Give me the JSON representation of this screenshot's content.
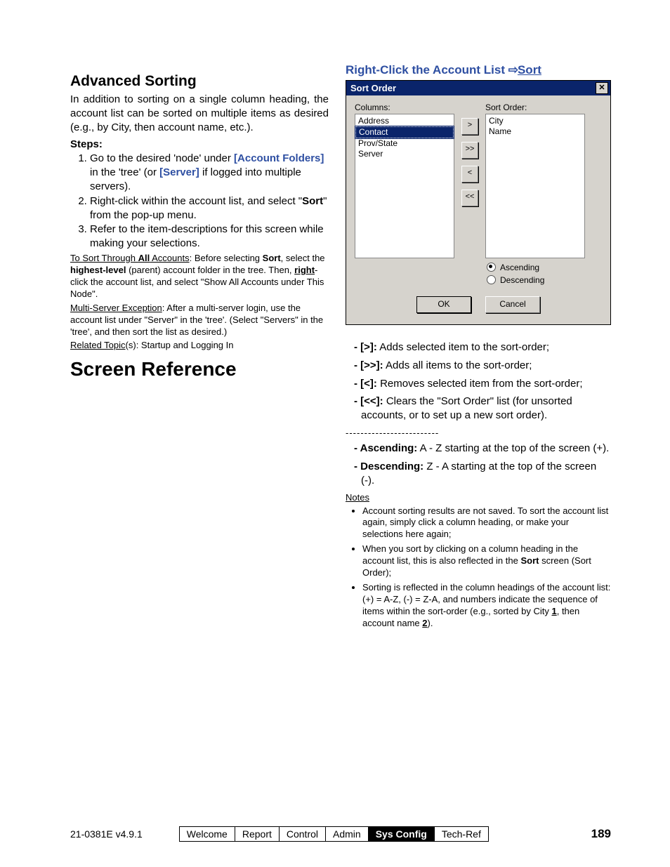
{
  "left": {
    "heading_advanced": "Advanced Sorting",
    "intro": "In addition to sorting on a single column heading, the account list can be sorted on multiple items as desired (e.g., by City, then account name, etc.).",
    "steps_label": "Steps:",
    "steps": {
      "s1_a": "Go to the desired 'node' under ",
      "s1_link1": "[Account Folders]",
      "s1_b": " in the 'tree' (or ",
      "s1_link2": "[Server]",
      "s1_c": " if logged into multiple servers).",
      "s2_a": "Right-click within the account list, and select \"",
      "s2_bold": "Sort",
      "s2_b": "\" from the pop-up menu.",
      "s3": "Refer to the item-descriptions for this screen while making your selections."
    },
    "note1_u": "To Sort Through ",
    "note1_bold": "All",
    "note1_a": " Accounts",
    "note1_b": ":  Before selecting ",
    "note1_sort": "Sort",
    "note1_c": ", select the ",
    "note1_hl": "highest-level",
    "note1_d": " (parent) account folder in the tree.  Then, ",
    "note1_right": "right",
    "note1_e": "-click the account list, and select \"Show All Accounts under This Node\".",
    "note2_u": "Multi-Server Exception",
    "note2": ":  After a multi-server login, use the account list under \"Server\" in the 'tree'.  (Select \"Servers\" in the 'tree', and then sort the list as desired.)",
    "related_u": "Related Topic",
    "related": "(s):  Startup and Logging In",
    "heading_screenref": "Screen Reference"
  },
  "right": {
    "heading_a": "Right-Click the Account List ",
    "heading_arrow": "⇨",
    "heading_sort": "Sort",
    "dialog": {
      "title": "Sort Order",
      "columns_label": "Columns:",
      "sortorder_label": "Sort Order:",
      "left_items": [
        "Address",
        "Contact",
        "Prov/State",
        "Server"
      ],
      "left_selected_index": 1,
      "right_items": [
        "City",
        "Name"
      ],
      "btn_add": ">",
      "btn_add_all": ">>",
      "btn_remove": "<",
      "btn_remove_all": "<<",
      "radio_asc": "Ascending",
      "radio_desc": "Descending",
      "radio_selected": "asc",
      "ok": "OK",
      "cancel": "Cancel"
    },
    "ref": {
      "l1_k": "- [>]:",
      "l1": "  Adds selected item to the sort-order;",
      "l2_k": "- [>>]:",
      "l2": "  Adds all items to the sort-order;",
      "l3_k": "- [<]:",
      "l3": "  Removes selected item from the sort-order;",
      "l4_k": "- [<<]:",
      "l4": "  Clears the \"Sort Order\" list (for unsorted accounts, or to set up a new sort order).",
      "sep": "-------------------------",
      "l5_k": "- Ascending:",
      "l5": "  A - Z starting at the top of the screen (+).",
      "l6_k": "- Descending:",
      "l6": "  Z - A starting at the top of the screen (-).",
      "notes_label": "Notes",
      "notes_colon": ":",
      "n1": "Account sorting results are not saved.  To sort the account list again, simply click a column heading, or make your selections here again;",
      "n2_a": "When you sort by clicking on a column heading in the account list, this is also reflected in the ",
      "n2_bold": "Sort",
      "n2_b": " screen (Sort Order);",
      "n3_a": "Sorting is reflected in the column headings of the account list:  (+) = A-Z,  (-) = Z-A,  and numbers indicate the sequence of items within the sort-order (e.g., sorted by City ",
      "n3_u1": "1",
      "n3_b": ", then account name ",
      "n3_u2": "2",
      "n3_c": ")."
    }
  },
  "footer": {
    "doc_id": "21-0381E v4.9.1",
    "tabs": [
      "Welcome",
      "Report",
      "Control",
      "Admin",
      "Sys Config",
      "Tech-Ref"
    ],
    "active_tab": "Sys Config",
    "page": "189"
  }
}
